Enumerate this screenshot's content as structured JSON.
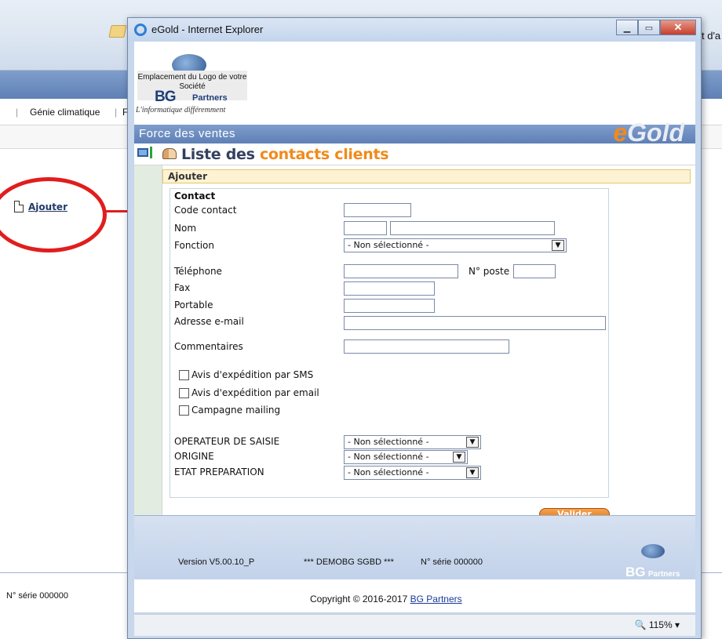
{
  "background": {
    "title_right_fragment": "t d'a",
    "menu_item": "Génie climatique",
    "menu_sep_1": "|",
    "menu_sep_2": "|",
    "menu_partial": "F",
    "ajouter_link": "Ajouter",
    "footer_serial": "N° série 000000"
  },
  "popup": {
    "window_title": "eGold - Internet Explorer",
    "logo_placeholder": "Emplacement du Logo de votre Société",
    "logo_bg": "BG",
    "logo_partners": "Partners",
    "logo_tagline": "L'informatique différemment",
    "force_des_ventes": "Force des ventes",
    "egold_e": "e",
    "egold_rest": "Gold",
    "page_title_prefix": "Liste des ",
    "page_title_highlight": "contacts clients",
    "ajouter_bar": "Ajouter"
  },
  "form": {
    "section_title": "Contact",
    "code_contact_label": "Code contact",
    "nom_label": "Nom",
    "fonction_label": "Fonction",
    "fonction_value": "- Non sélectionné -",
    "telephone_label": "Téléphone",
    "no_poste_label": "N° poste",
    "fax_label": "Fax",
    "portable_label": "Portable",
    "email_label": "Adresse e-mail",
    "commentaires_label": "Commentaires",
    "sms_label": "Avis d'expédition par SMS",
    "email_notice_label": "Avis d'expédition par email",
    "mailing_label": "Campagne mailing",
    "operateur_label": "OPERATEUR DE SAISIE",
    "operateur_value": "- Non sélectionné -",
    "origine_label": "ORIGINE",
    "origine_value": "- Non sélectionné -",
    "etat_label": "ETAT PREPARATION",
    "etat_value": "- Non sélectionné -",
    "valider": "Valider"
  },
  "footer": {
    "version": "Version V5.00.10_P",
    "demo": "*** DEMOBG SGBD ***",
    "serial": "N° série 000000",
    "logo_bg": "BG",
    "logo_partners": "Partners",
    "copyright_text": "Copyright © 2016-2017 ",
    "copyright_link": "BG Partners"
  },
  "statusbar": {
    "zoom": "115%"
  },
  "colors": {
    "accent_orange": "#f08a1c",
    "header_blue": "#6f8fc1",
    "annotation_red": "#e11d1d"
  }
}
